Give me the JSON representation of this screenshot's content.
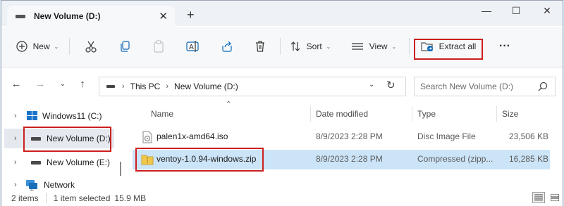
{
  "window": {
    "tab_title": "New Volume (D:)",
    "tab_close": "✕",
    "new_tab": "+",
    "controls": {
      "minimize": "—",
      "maximize": "☐",
      "close": "✕"
    }
  },
  "toolbar": {
    "new_label": "New",
    "sort_label": "Sort",
    "view_label": "View",
    "extract_label": "Extract all",
    "more_label": "···"
  },
  "address": {
    "crumbs": [
      "This PC",
      "New Volume (D:)"
    ],
    "search_placeholder": "Search New Volume (D:)"
  },
  "sidebar": {
    "items": [
      {
        "label": "Windows11 (C:)",
        "icon": "windows-drive-icon"
      },
      {
        "label": "New Volume (D:)",
        "icon": "drive-icon",
        "selected": true
      },
      {
        "label": "New Volume (E:)",
        "icon": "drive-icon"
      },
      {
        "label": "Network",
        "icon": "network-icon"
      }
    ]
  },
  "columns": {
    "name": "Name",
    "date": "Date modified",
    "type": "Type",
    "size": "Size"
  },
  "files": [
    {
      "name": "palen1x-amd64.iso",
      "date": "8/9/2023 2:28 PM",
      "type": "Disc Image File",
      "size": "23,506 KB",
      "icon": "disc-image-icon"
    },
    {
      "name": "ventoy-1.0.94-windows.zip",
      "date": "8/9/2023 2:28 PM",
      "type": "Compressed (zipp...",
      "size": "16,285 KB",
      "icon": "zip-folder-icon",
      "selected": true
    }
  ],
  "status": {
    "items": "2 items",
    "selected": "1 item selected",
    "size": "15.9 MB"
  },
  "colors": {
    "highlight_box": "#cc1f1f",
    "selection": "#cce4f7",
    "accent": "#0067c0"
  }
}
